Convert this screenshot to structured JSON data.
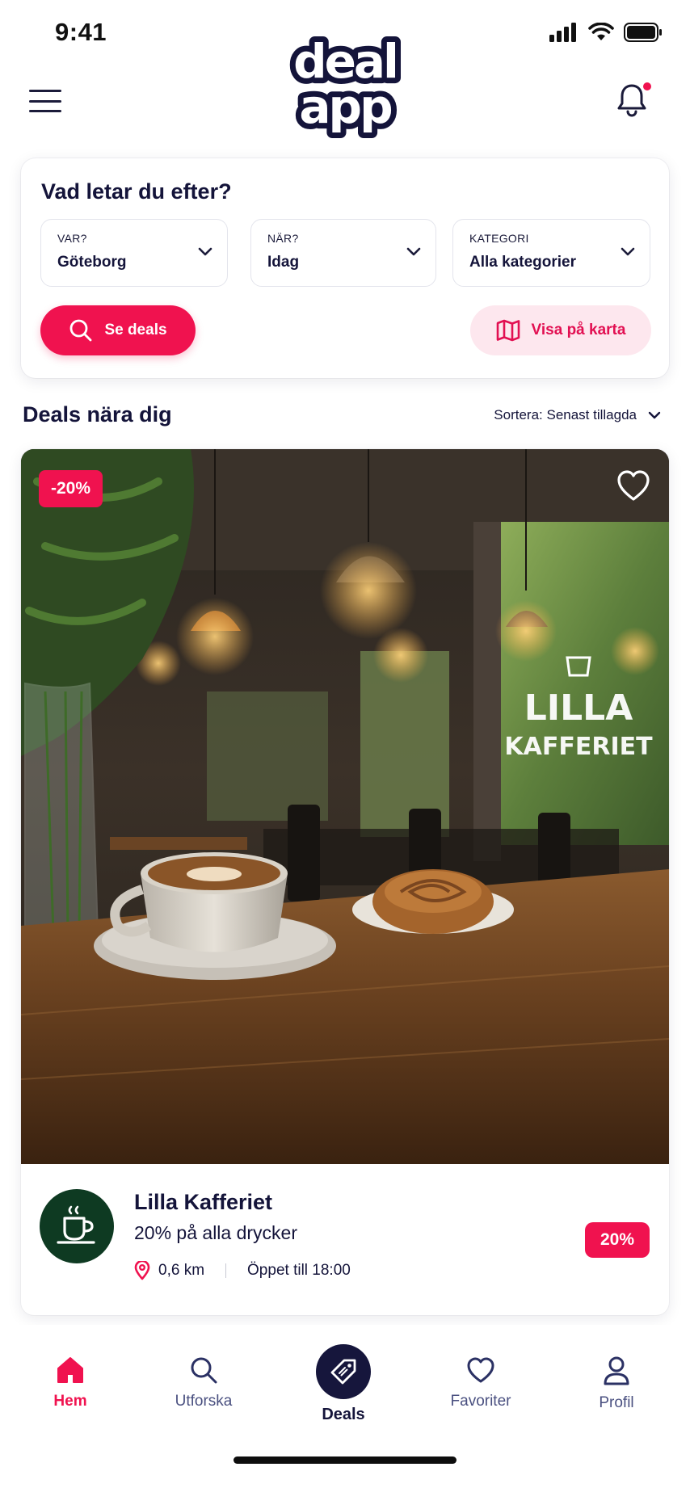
{
  "status_bar": {
    "time": "9:41"
  },
  "header": {
    "logo_line1": "deal",
    "logo_line2": "app",
    "has_notification": true
  },
  "search": {
    "title": "Vad letar du efter?",
    "filters": [
      {
        "label": "VAR?",
        "value": "Göteborg"
      },
      {
        "label": "NÄR?",
        "value": "Idag"
      },
      {
        "label": "KATEGORI",
        "value": "Alla kategorier"
      }
    ],
    "primary_button": "Se deals",
    "secondary_button": "Visa på karta"
  },
  "section": {
    "title": "Deals nära dig",
    "sort_label": "Sortera: Senast tillagda"
  },
  "deal": {
    "image_discount": "-20%",
    "name": "Lilla Kafferiet",
    "description": "20% på alla drycker",
    "distance": "0,6 km",
    "hours": "Öppet till 18:00",
    "badge": "20%",
    "window_sign_line1": "LILLA",
    "window_sign_line2": "KAFFERIET"
  },
  "nav": {
    "items": [
      {
        "label": "Hem",
        "icon": "home-icon",
        "active": true
      },
      {
        "label": "Utforska",
        "icon": "search-icon",
        "active": false
      },
      {
        "label": "Deals",
        "icon": "tag-icon",
        "active": false
      },
      {
        "label": "Favoriter",
        "icon": "heart-icon",
        "active": false
      },
      {
        "label": "Profil",
        "icon": "user-icon",
        "active": false
      }
    ]
  },
  "colors": {
    "brand_pink": "#f0124f",
    "brand_navy": "#16163c",
    "pink_tint": "#fde7ee",
    "avatar_green": "#0e3a22"
  }
}
